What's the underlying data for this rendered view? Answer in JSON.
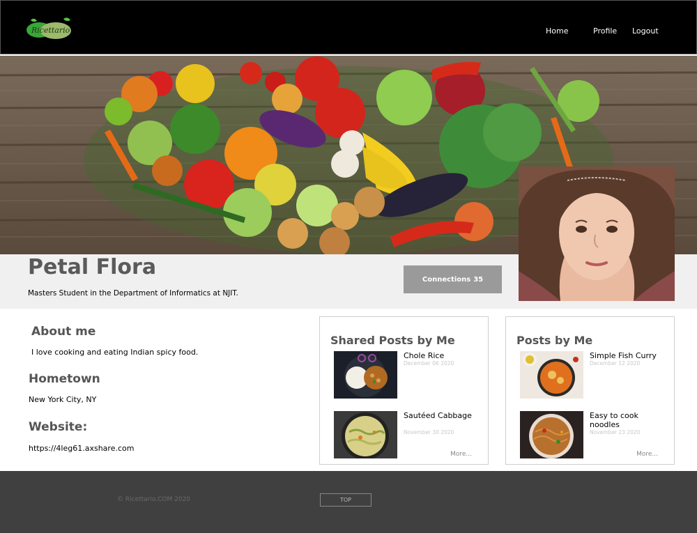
{
  "header": {
    "logo_text": "Ricettario",
    "nav": {
      "home": "Home",
      "profile": "Profile",
      "logout": "Logout"
    }
  },
  "profile": {
    "name": "Petal Flora",
    "tagline": "Masters Student in the Department of Informatics at NJIT.",
    "connections_label": "Connections",
    "connections_count": "35"
  },
  "about": {
    "about_heading": "About me",
    "about_text": "I love cooking and eating Indian spicy food.",
    "hometown_heading": "Hometown",
    "hometown_text": "New York City, NY",
    "website_heading": "Website:",
    "website_text": "https://4leg61.axshare.com"
  },
  "shared_posts": {
    "title": "Shared Posts by Me",
    "items": [
      {
        "title": "Chole Rice",
        "date": "December 06 2020"
      },
      {
        "title": "Sautéed Cabbage",
        "date": "November 30 2020"
      }
    ],
    "more": "More..."
  },
  "my_posts": {
    "title": "Posts by Me",
    "items": [
      {
        "title": "Simple Fish Curry",
        "date": "December 12 2020"
      },
      {
        "title": "Easy to cook noodles",
        "date": "November 23 2020"
      }
    ],
    "more": "More..."
  },
  "footer": {
    "copyright": "© Ricettario.COM 2020",
    "top_button": "TOP"
  },
  "colors": {
    "header_bg": "#000000",
    "profile_strip_bg": "#f0f0f0",
    "connections_btn_bg": "#9a9a9a",
    "heading_color": "#555555",
    "footer_bg": "#404040"
  }
}
